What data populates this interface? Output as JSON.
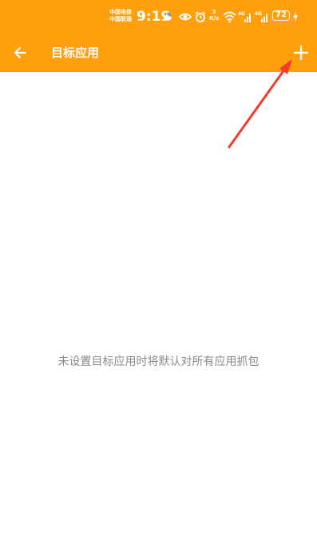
{
  "status_bar": {
    "carrier_1": "中国电信",
    "carrier_2": "中国联通",
    "time": "9:19",
    "net_speed_value": "3",
    "net_speed_unit": "K/s",
    "battery": "72",
    "icons": [
      "weather-icon",
      "eye-icon",
      "alarm-icon",
      "wifi-icon",
      "signal-4g-icon",
      "signal-4g-icon",
      "charging-icon"
    ]
  },
  "app_bar": {
    "title": "目标应用",
    "back_icon": "arrow-left-icon",
    "add_icon": "plus-icon"
  },
  "main": {
    "empty_message": "未设置目标应用时将默认对所有应用抓包"
  },
  "colors": {
    "primary": "#ff9f0e",
    "annotation_arrow": "#f23b2c",
    "empty_text": "#8a8a8a"
  }
}
